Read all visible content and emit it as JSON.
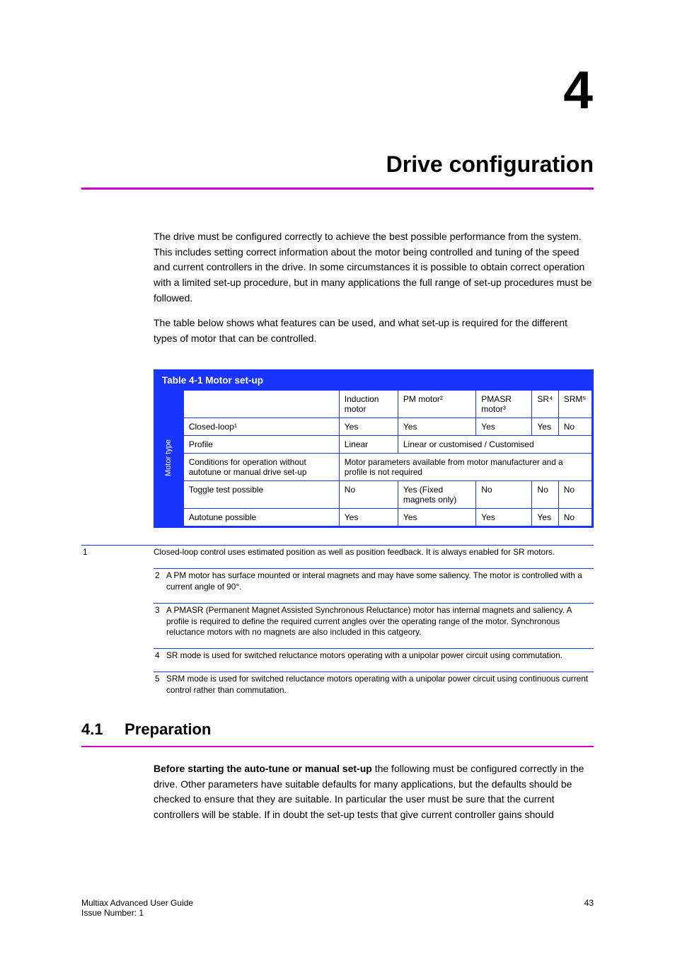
{
  "chapter": {
    "number": "4",
    "title": "Drive configuration"
  },
  "intro": {
    "p1": "The drive must be configured correctly to achieve the best possible performance from the system. This includes setting correct information about the motor being controlled and tuning of the speed and current controllers in the drive. In some circumstances it is possible to obtain correct operation with a limited set-up procedure, but in many applications the full range of set-up procedures must be followed.",
    "p2": "The table below shows what features can be used, and what set-up is required for the different types of motor that can be controlled."
  },
  "table": {
    "title": "Table 4-1 Motor set-up",
    "side_label": "Motor type",
    "columns": [
      "",
      "Induction motor",
      "PM motor²",
      "PMASR motor³",
      "SR⁴",
      "SRM⁵"
    ],
    "rows": [
      {
        "label": "Closed-loop¹",
        "cells": [
          "Yes",
          "Yes",
          "Yes",
          "Yes",
          "No"
        ]
      },
      {
        "label": "Profile",
        "cells": [
          "Linear",
          "Linear or customised",
          "Customised",
          "Customised",
          "Customised"
        ],
        "colspan_first": true
      }
    ],
    "cond_label": "Conditions for operation without autotune or manual drive set-up",
    "cond_value": "Motor parameters available from motor manufacturer and a profile is not required",
    "toggle_label": "Toggle test possible",
    "toggle_cells": [
      "No",
      "Yes (Fixed magnets only)",
      "No",
      "No",
      "No"
    ],
    "autotune_label": "Autotune possible",
    "autotune_cells": [
      "Yes",
      "Yes",
      "Yes",
      "Yes",
      "No"
    ]
  },
  "footnotes": [
    {
      "n": "1",
      "text": "Closed-loop control uses estimated position as well as position feedback. It is always enabled for SR motors."
    },
    {
      "n": "2",
      "text": "A PM motor has surface mounted or interal magnets and may have some saliency. The motor is controlled with a current angle of 90°."
    },
    {
      "n": "3",
      "text": "A PMASR (Permanent Magnet Assisted Synchronous Reluctance) motor has internal magnets and saliency. A profile is required to define the required current angles over the operating range of the motor. Synchronous reluctance motors with no magnets are also included in this catgeory."
    },
    {
      "n": "4",
      "text": "SR mode is used for switched reluctance motors operating with a unipolar power circuit using commutation."
    },
    {
      "n": "5",
      "text": "SRM mode is used for switched reluctance motors operating with a unipolar power circuit using continuous current control rather than commutation."
    }
  ],
  "section": {
    "number": "4.1",
    "title": "Preparation",
    "lead": "Before starting the auto-tune or manual set-up",
    "body": "the following must be configured correctly in the drive. Other parameters have suitable defaults for many applications, but the defaults should be checked to ensure that they are suitable. In particular the user must be sure that the current controllers will be stable. If in doubt the set-up tests that give current controller gains should"
  },
  "footer": {
    "left": "Multiax Advanced User Guide",
    "right": "43",
    "below": "Issue Number: 1"
  }
}
